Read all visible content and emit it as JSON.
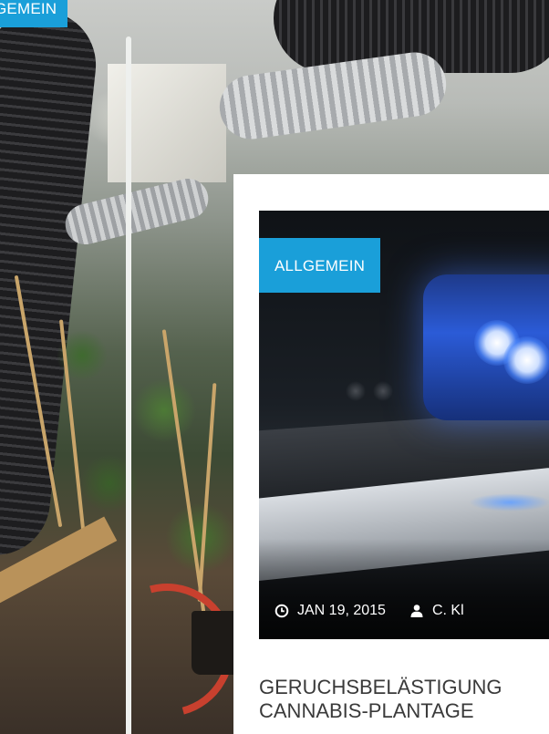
{
  "back_card": {
    "category": "GEMEIN"
  },
  "front_card": {
    "category": "ALLGEMEIN",
    "date": "JAN 19, 2015",
    "author": "C. Kl",
    "title_line1": "GERUCHSBELÄSTIGUNG",
    "title_line2": "CANNABIS-PLANTAGE"
  },
  "colors": {
    "badge": "#1a9fd9",
    "title_text": "#3a3a3a"
  },
  "icons": {
    "date": "clock-icon",
    "author": "user-icon"
  }
}
